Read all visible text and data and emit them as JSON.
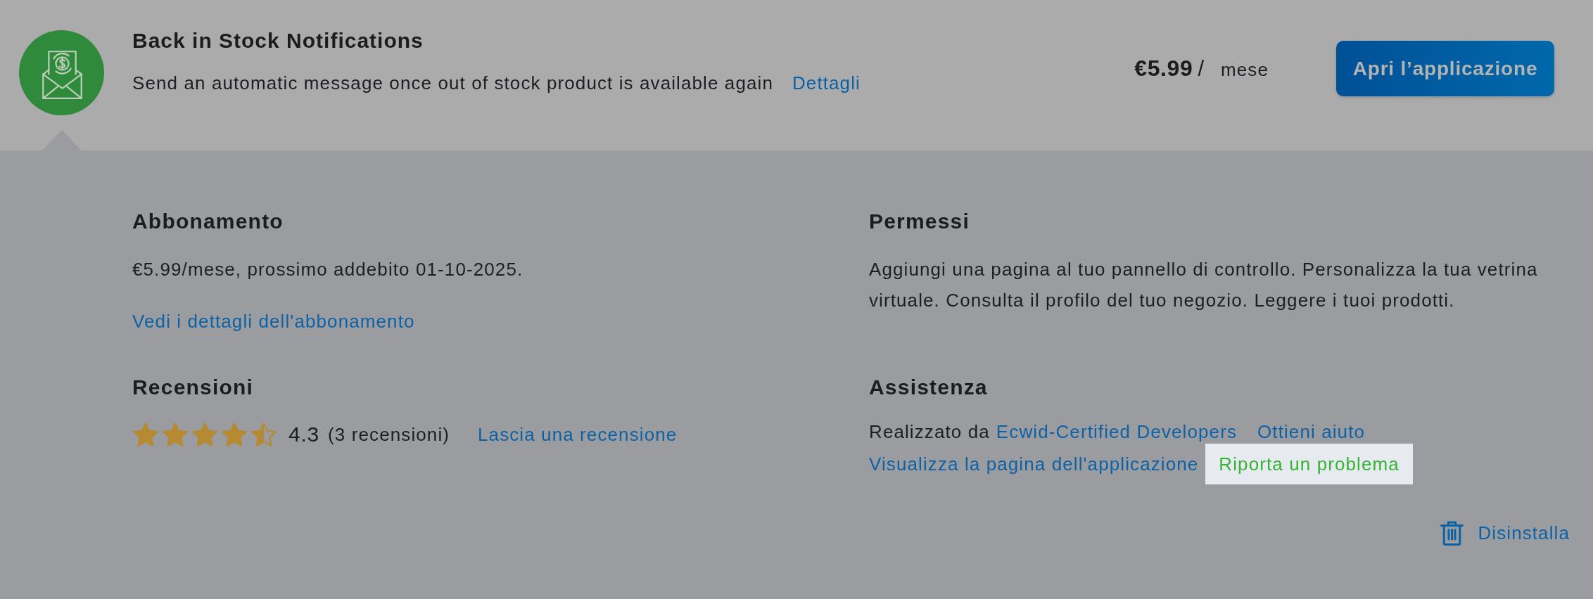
{
  "app": {
    "title": "Back in Stock Notifications",
    "description": "Send an automatic message once out of stock product is available again",
    "details_link": "Dettagli",
    "price_amount": "€5.99",
    "price_separator": "/",
    "price_period": "mese",
    "open_button": "Apri l’applicazione"
  },
  "subscription": {
    "heading": "Abbonamento",
    "text": "€5.99/mese, prossimo addebito 01-10-2025.",
    "link": "Vedi i dettagli dell'abbonamento"
  },
  "permissions": {
    "heading": "Permessi",
    "text": "Aggiungi una pagina al tuo pannello di controllo. Personalizza la tua vetrina virtuale. Consulta il profilo del tuo negozio. Leggere i tuoi prodotti."
  },
  "reviews": {
    "heading": "Recensioni",
    "stars": 4.5,
    "score": "4.3",
    "count": "(3 recensioni)",
    "link": "Lascia una recensione"
  },
  "support": {
    "heading": "Assistenza",
    "made_by": "Realizzato da",
    "developer_link": "Ecwid-Certified Developers",
    "links": [
      {
        "label": "Ottieni aiuto",
        "highlighted": false
      },
      {
        "label": "Visualizza la pagina dell'applicazione",
        "highlighted": false
      },
      {
        "label": "Riporta un problema",
        "highlighted": true
      }
    ]
  },
  "uninstall": {
    "label": "Disinstalla"
  }
}
